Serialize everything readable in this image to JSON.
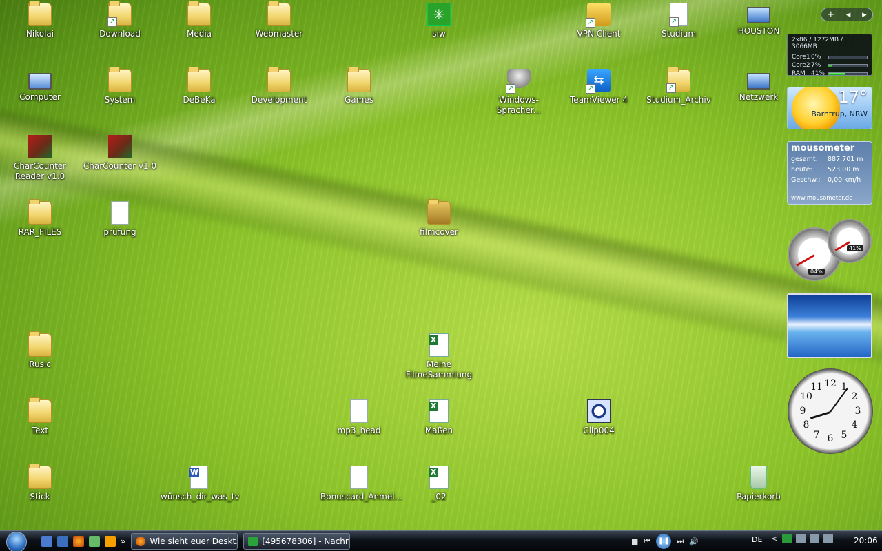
{
  "desktop": {
    "icons": {
      "nikolai": "Nikolai",
      "download": "Download",
      "media": "Media",
      "webmaster": "Webmaster",
      "siw": "siw",
      "vpn": "VPN Client",
      "studium": "Studium",
      "houston": "HOUSTON",
      "computer": "Computer",
      "system": "System",
      "debeka": "DeBeKa",
      "development": "Development",
      "games": "Games",
      "speech": "Windows-Spracher...",
      "teamviewer": "TeamViewer 4",
      "studium_archiv": "Studium_Archiv",
      "netzwerk": "Netzwerk",
      "charcounter_reader": "CharCounter Reader v1.0",
      "charcounter": "CharCounter v1.0",
      "rar_files": "RAR_FILES",
      "pruefung": "prüfung",
      "filmcover": "filmcover",
      "rusic": "Rusic",
      "filmsammlung": "Meine FilmeSammlung",
      "text": "Text",
      "mp3_head": "mp3_head",
      "masse": "Maßen",
      "clip004": "Clip004",
      "stick": "Stick",
      "wunsch": "wünsch_dir_was_tv",
      "bonuscard": "Bonuscard_Anmel...",
      "file_02": "_02",
      "papierkorb": "Papierkorb"
    }
  },
  "sidebar": {
    "controls": {
      "add": "+",
      "prev": "◂",
      "next": "▸"
    },
    "cpu": {
      "header": "2x86 / 1272MB / 3066MB",
      "rows": [
        {
          "label": "Core1",
          "value": "0%",
          "level": 0.0
        },
        {
          "label": "Core2",
          "value": "7%",
          "level": 0.07
        },
        {
          "label": "RAM",
          "value": "41%",
          "level": 0.41
        }
      ]
    },
    "weather": {
      "temp": "17°",
      "city": "Barntrup, NRW"
    },
    "mousometer": {
      "title": "mousometer",
      "rows": [
        {
          "k": "gesamt:",
          "v": "887.701 m"
        },
        {
          "k": "heute:",
          "v": "523,00 m"
        },
        {
          "k": "Geschw.:",
          "v": "0,00 km/h"
        }
      ],
      "url": "www.mousometer.de"
    },
    "meter": {
      "cpu": "04%",
      "mem": "41%"
    },
    "clock": {
      "numbers": [
        "12",
        "1",
        "2",
        "3",
        "4",
        "5",
        "6",
        "7",
        "8",
        "9",
        "10",
        "11"
      ],
      "time": "20:06"
    }
  },
  "taskbar": {
    "quicklaunch_more": "»",
    "tasks": [
      "Wie sieht euer Deskt...",
      "[495678306] - Nachr..."
    ],
    "lang": "DE",
    "tray_chevron": "<",
    "time": "20:06"
  }
}
